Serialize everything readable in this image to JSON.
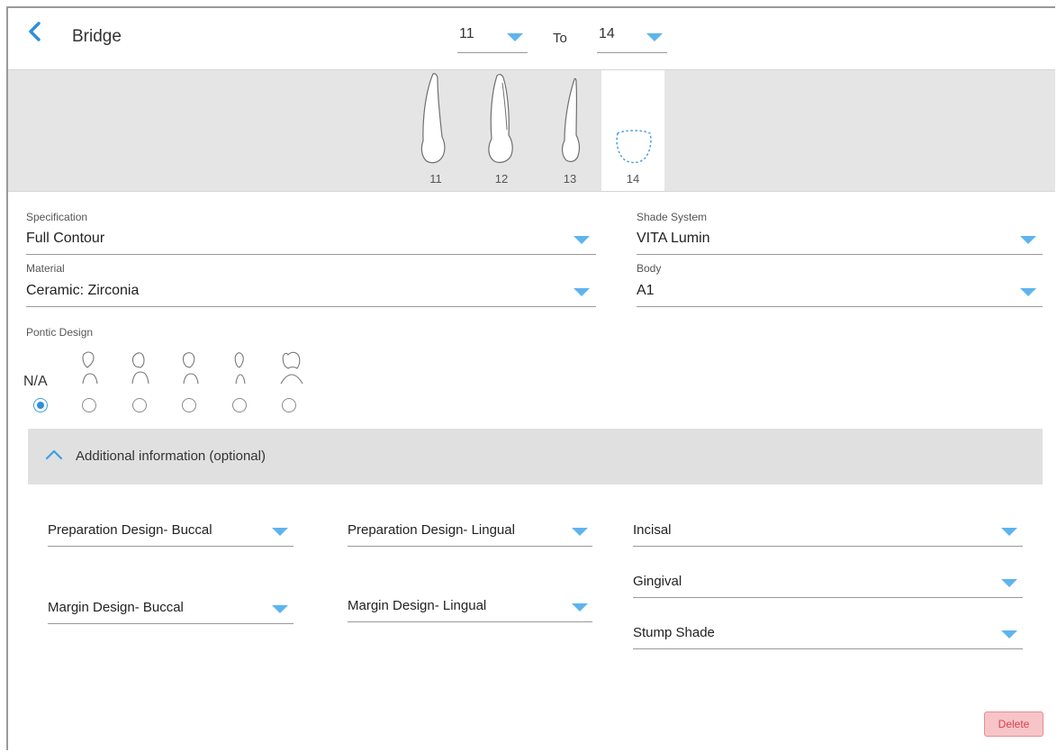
{
  "header": {
    "title": "Bridge",
    "from": "11",
    "to_label": "To",
    "to": "14"
  },
  "teeth": [
    {
      "number": "11",
      "selected": false
    },
    {
      "number": "12",
      "selected": false
    },
    {
      "number": "13",
      "selected": false
    },
    {
      "number": "14",
      "selected": true
    }
  ],
  "form": {
    "specification": {
      "label": "Specification",
      "value": "Full Contour"
    },
    "shade_system": {
      "label": "Shade System",
      "value": "VITA Lumin"
    },
    "material": {
      "label": "Material",
      "value": "Ceramic: Zirconia"
    },
    "body": {
      "label": "Body",
      "value": "A1"
    }
  },
  "pontic": {
    "label": "Pontic Design",
    "na_label": "N/A",
    "selected_index": 0,
    "option_count": 6
  },
  "additional": {
    "header": "Additional information (optional)",
    "expanded": true,
    "fields": {
      "prep_buccal": "Preparation Design- Buccal",
      "prep_lingual": "Preparation Design- Lingual",
      "incisal": "Incisal",
      "gingival": "Gingival",
      "margin_buccal": "Margin Design- Buccal",
      "margin_lingual": "Margin Design- Lingual",
      "stump_shade": "Stump Shade"
    }
  },
  "actions": {
    "delete": "Delete"
  },
  "colors": {
    "accent": "#5eb4ee",
    "radio_selected": "#2e8fdc",
    "delete_bg": "#f7c4c8",
    "delete_text": "#d9424f"
  }
}
